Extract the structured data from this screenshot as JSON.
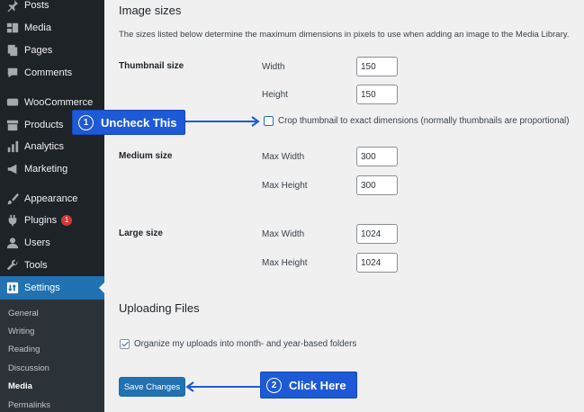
{
  "sidebar": {
    "items": [
      {
        "label": "Posts",
        "icon": "pin-icon"
      },
      {
        "label": "Media",
        "icon": "media-icon"
      },
      {
        "label": "Pages",
        "icon": "pages-icon"
      },
      {
        "label": "Comments",
        "icon": "comments-icon"
      },
      {
        "label": "WooCommerce",
        "icon": "woo-icon"
      },
      {
        "label": "Products",
        "icon": "archive-icon"
      },
      {
        "label": "Analytics",
        "icon": "chart-icon"
      },
      {
        "label": "Marketing",
        "icon": "megaphone-icon"
      },
      {
        "label": "Appearance",
        "icon": "brush-icon"
      },
      {
        "label": "Plugins",
        "icon": "plug-icon",
        "badge": "1"
      },
      {
        "label": "Users",
        "icon": "user-icon"
      },
      {
        "label": "Tools",
        "icon": "wrench-icon"
      },
      {
        "label": "Settings",
        "icon": "settings-icon",
        "active": true
      }
    ],
    "submenu": [
      {
        "label": "General"
      },
      {
        "label": "Writing"
      },
      {
        "label": "Reading"
      },
      {
        "label": "Discussion"
      },
      {
        "label": "Media",
        "current": true
      },
      {
        "label": "Permalinks"
      }
    ]
  },
  "main": {
    "title": "Image sizes",
    "description": "The sizes listed below determine the maximum dimensions in pixels to use when adding an image to the Media Library.",
    "thumbnail": {
      "label": "Thumbnail size",
      "width_label": "Width",
      "width_value": "150",
      "height_label": "Height",
      "height_value": "150",
      "crop_label": "Crop thumbnail to exact dimensions (normally thumbnails are proportional)",
      "crop_checked": false
    },
    "medium": {
      "label": "Medium size",
      "width_label": "Max Width",
      "width_value": "300",
      "height_label": "Max Height",
      "height_value": "300"
    },
    "large": {
      "label": "Large size",
      "width_label": "Max Width",
      "width_value": "1024",
      "height_label": "Max Height",
      "height_value": "1024"
    },
    "uploading": {
      "title": "Uploading Files",
      "organize_label": "Organize my uploads into month- and year-based folders",
      "organize_checked": true
    },
    "save_label": "Save Changes"
  },
  "callouts": [
    {
      "number": "1",
      "text": "Uncheck This"
    },
    {
      "number": "2",
      "text": "Click Here"
    }
  ],
  "colors": {
    "sidebar_bg": "#1d2327",
    "accent": "#2271b1",
    "callout": "#1e5ad6",
    "badge": "#d63638"
  }
}
